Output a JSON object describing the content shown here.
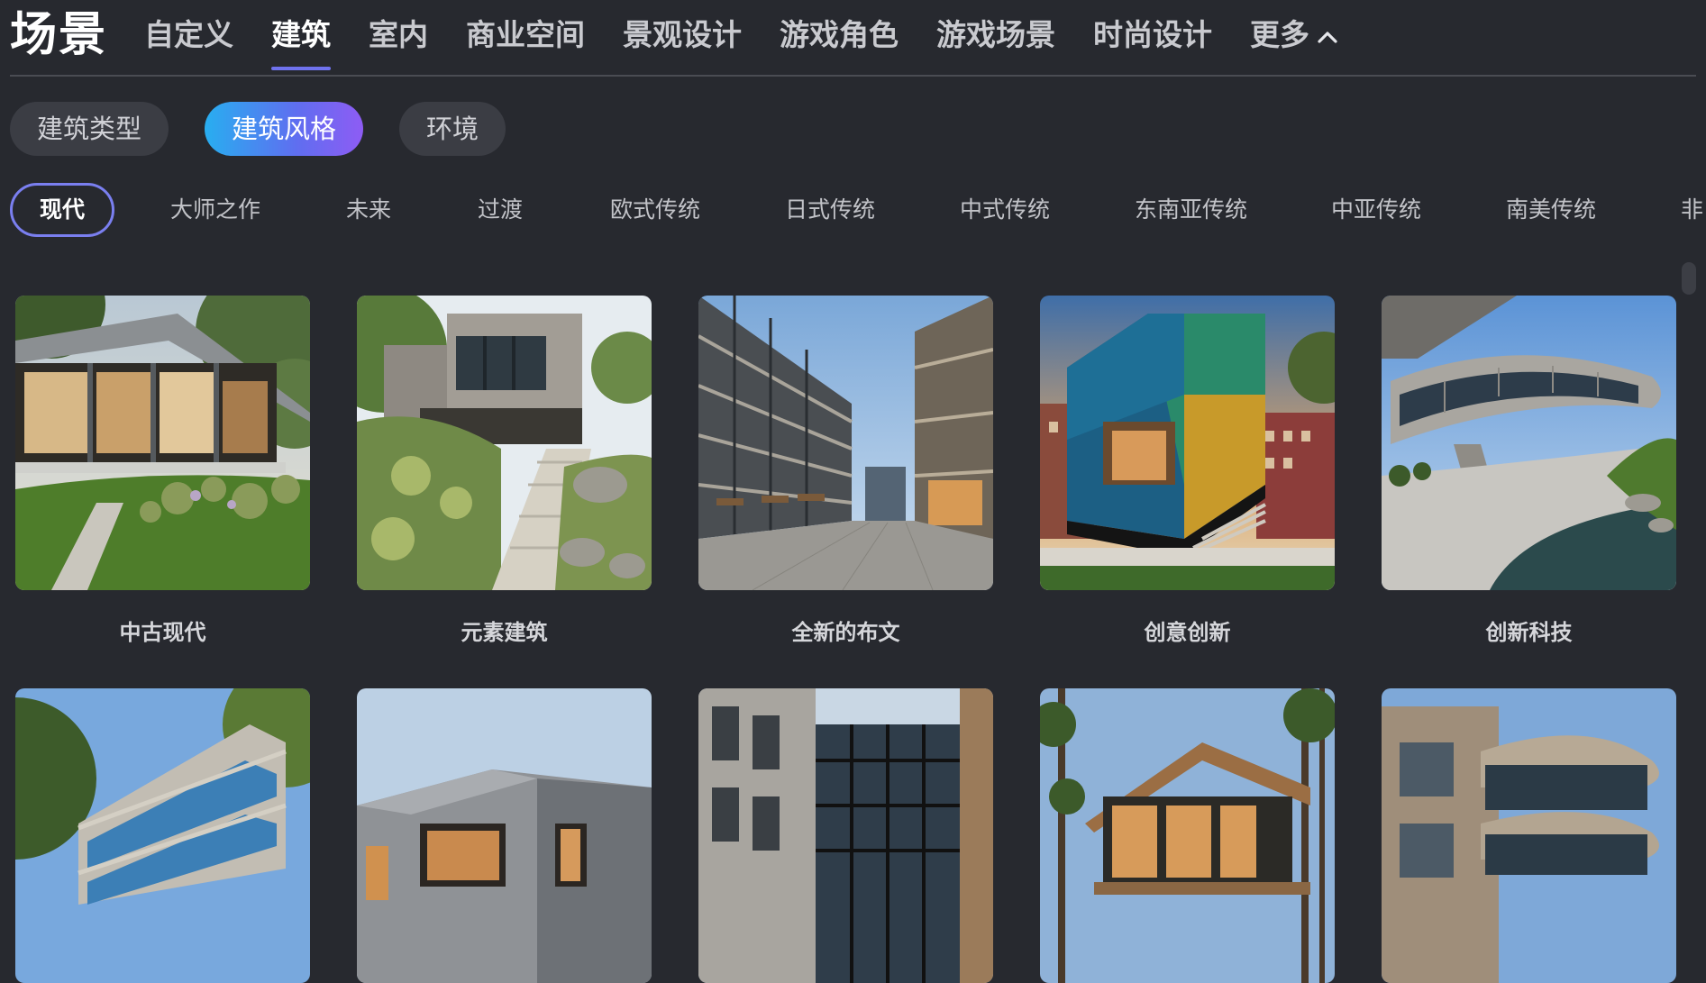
{
  "header": {
    "title": "场景"
  },
  "top_tabs": [
    {
      "label": "自定义"
    },
    {
      "label": "建筑"
    },
    {
      "label": "室内"
    },
    {
      "label": "商业空间"
    },
    {
      "label": "景观设计"
    },
    {
      "label": "游戏角色"
    },
    {
      "label": "游戏场景"
    },
    {
      "label": "时尚设计"
    },
    {
      "label": "更多"
    }
  ],
  "active_top_tab": "建筑",
  "sub_tabs": [
    {
      "label": "建筑类型"
    },
    {
      "label": "建筑风格"
    },
    {
      "label": "环境"
    }
  ],
  "active_sub_tab": "建筑风格",
  "styles": [
    {
      "label": "现代"
    },
    {
      "label": "大师之作"
    },
    {
      "label": "未来"
    },
    {
      "label": "过渡"
    },
    {
      "label": "欧式传统"
    },
    {
      "label": "日式传统"
    },
    {
      "label": "中式传统"
    },
    {
      "label": "东南亚传统"
    },
    {
      "label": "中亚传统"
    },
    {
      "label": "南美传统"
    },
    {
      "label": "非"
    }
  ],
  "active_style": "现代",
  "cards": [
    {
      "caption": "中古现代"
    },
    {
      "caption": "元素建筑"
    },
    {
      "caption": "全新的布文"
    },
    {
      "caption": "创意创新"
    },
    {
      "caption": "创新科技"
    }
  ],
  "colors": {
    "background": "#27292f",
    "accent": "#6f72ee",
    "pill_gradient_start": "#28aef0",
    "pill_gradient_end": "#8e5cf4"
  }
}
